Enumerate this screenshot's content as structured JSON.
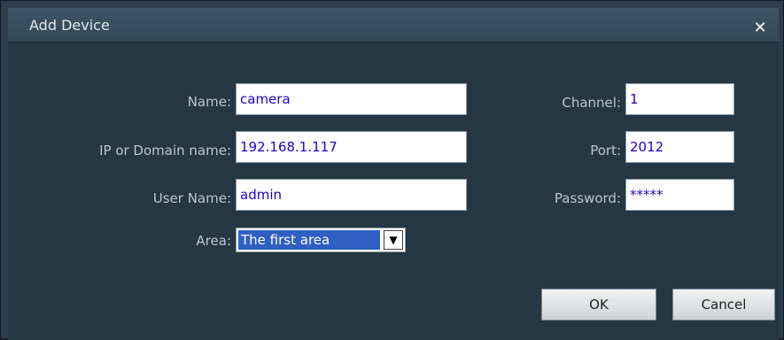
{
  "window": {
    "title": "Add Device",
    "close_glyph": "✕"
  },
  "form": {
    "name_label": "Name:",
    "name_value": "camera",
    "ip_label": "IP or Domain name:",
    "ip_value": "192.168.1.117",
    "username_label": "User Name:",
    "username_value": "admin",
    "area_label": "Area:",
    "area_value": "The first area",
    "channel_label": "Channel:",
    "channel_value": "1",
    "port_label": "Port:",
    "port_value": "2012",
    "password_label": "Password:",
    "password_value": "*****"
  },
  "buttons": {
    "ok_label": "OK",
    "cancel_label": "Cancel"
  },
  "colors": {
    "dialog_background": "#263744",
    "input_text": "#2200cc",
    "selection": "#2f5fc2"
  },
  "icons": {
    "close": "close-icon",
    "dropdown": "chevron-down-icon"
  }
}
